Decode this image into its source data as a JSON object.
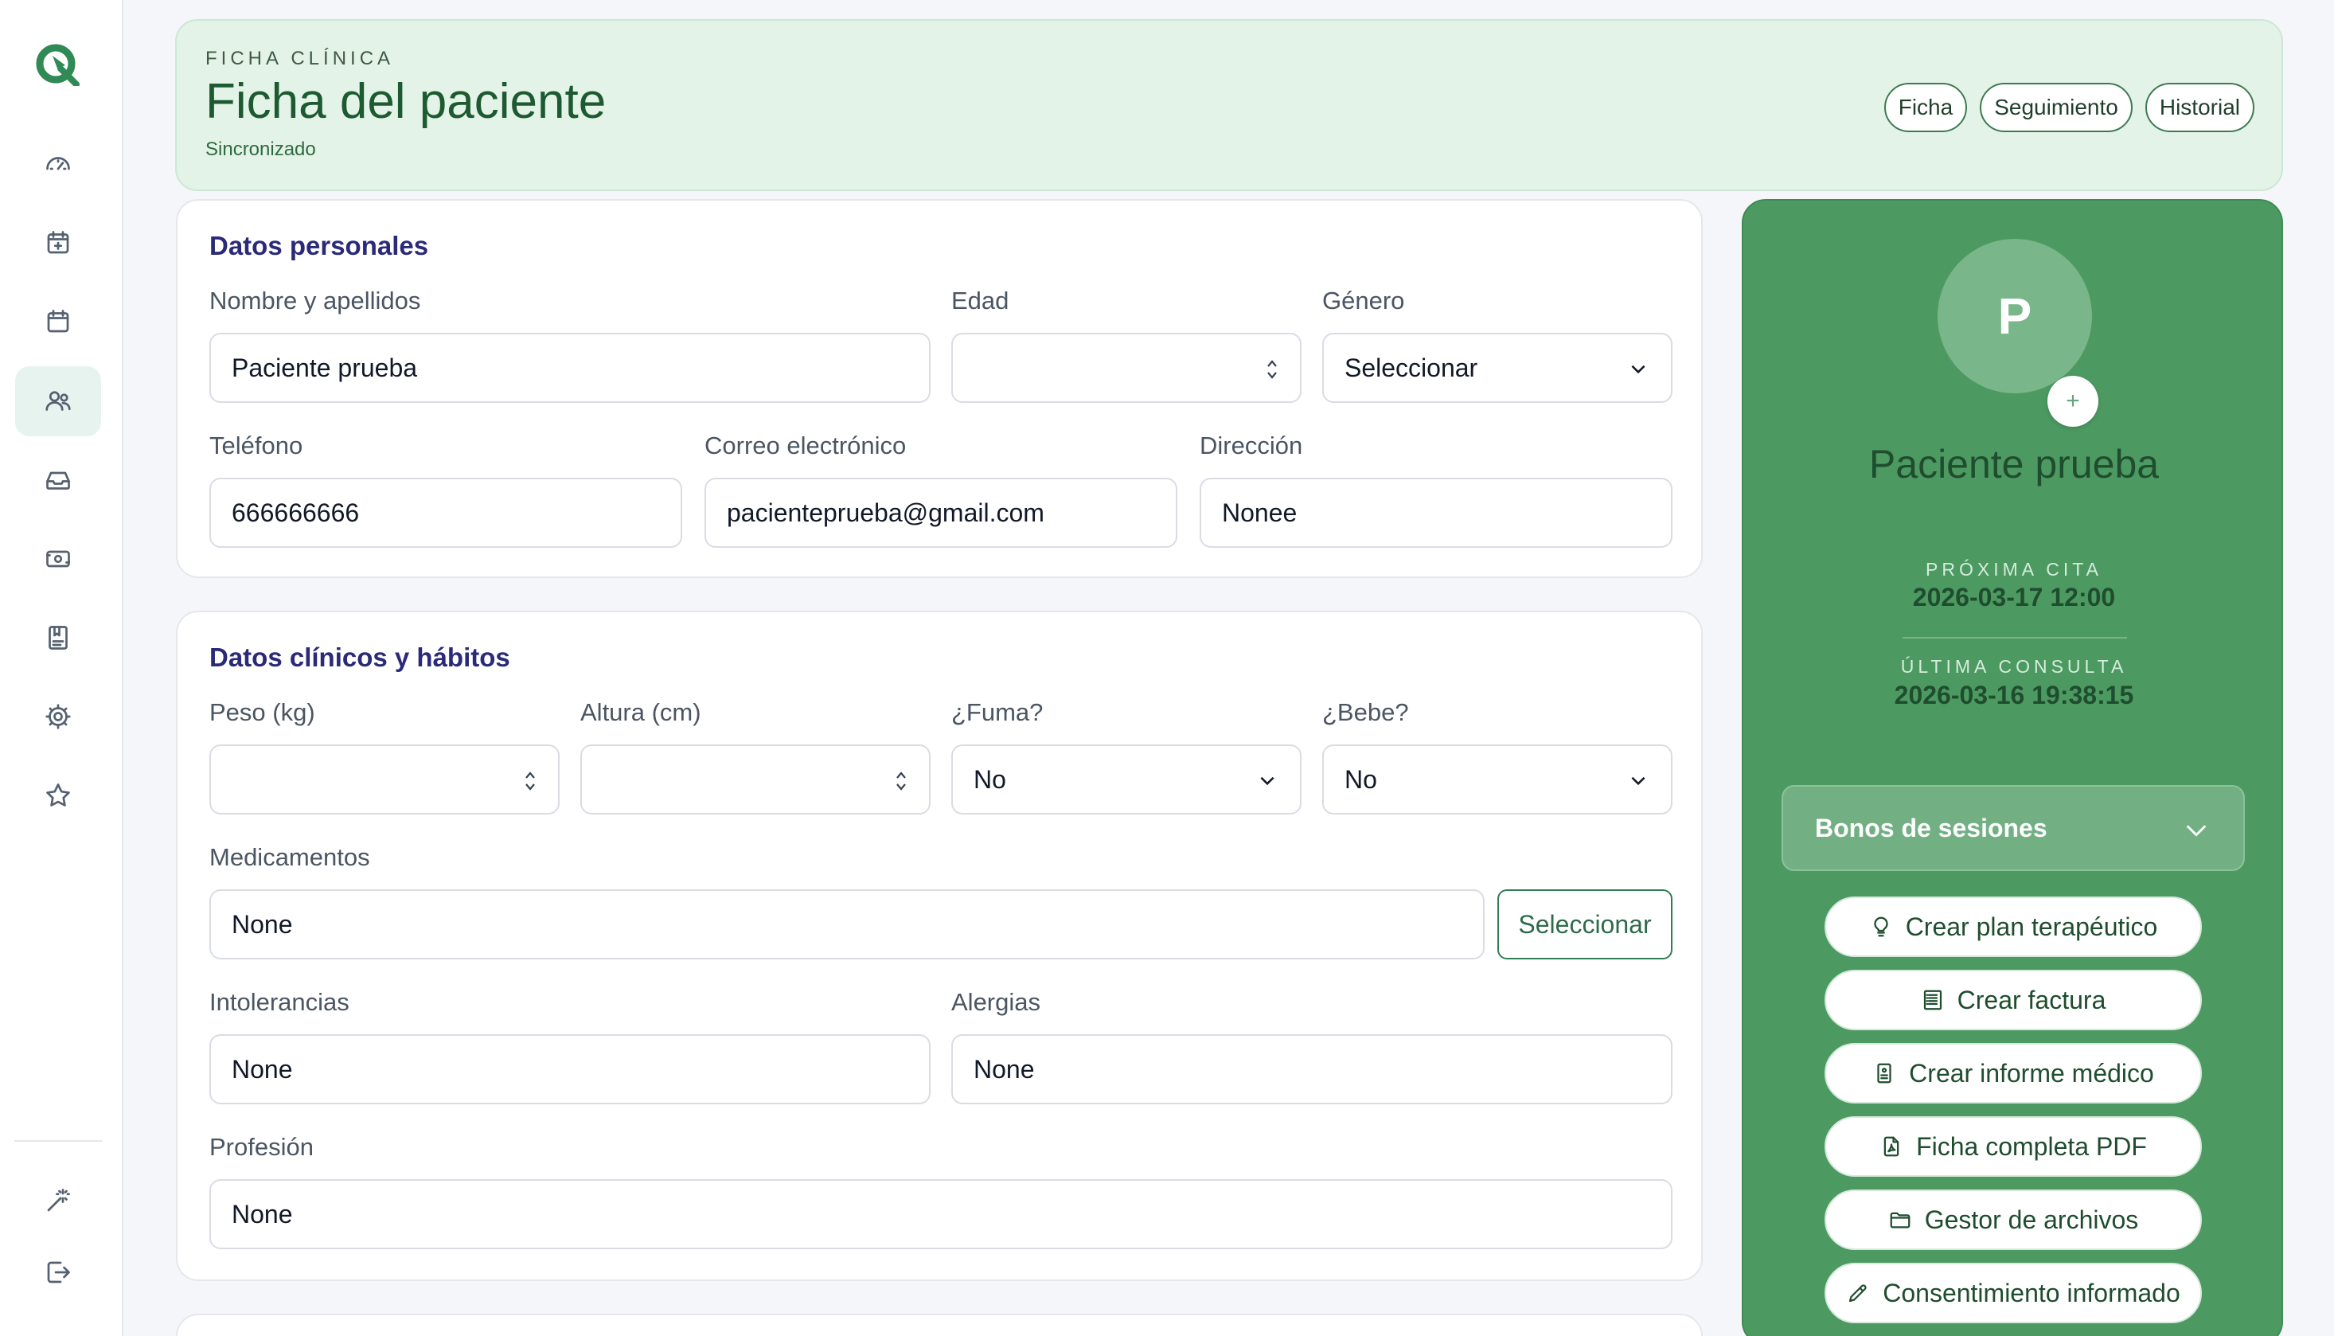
{
  "header": {
    "eyebrow": "FICHA CLÍNICA",
    "title": "Ficha del paciente",
    "sync_status": "Sincronizado",
    "tabs": [
      {
        "label": "Ficha"
      },
      {
        "label": "Seguimiento"
      },
      {
        "label": "Historial"
      }
    ]
  },
  "sidebar": {
    "items": [
      {
        "icon": "dashboard-icon"
      },
      {
        "icon": "calendar-add-icon"
      },
      {
        "icon": "calendar-icon"
      },
      {
        "icon": "patients-icon",
        "active": true
      },
      {
        "icon": "inbox-icon"
      },
      {
        "icon": "money-icon"
      },
      {
        "icon": "book-icon"
      },
      {
        "icon": "settings-icon"
      },
      {
        "icon": "star-icon"
      },
      {
        "icon": "magic-wand-icon"
      },
      {
        "icon": "logout-icon"
      }
    ]
  },
  "personal": {
    "title": "Datos personales",
    "name_label": "Nombre y apellidos",
    "name_value": "Paciente prueba",
    "age_label": "Edad",
    "age_value": "",
    "gender_label": "Género",
    "gender_value": "Seleccionar",
    "phone_label": "Teléfono",
    "phone_value": "666666666",
    "email_label": "Correo electrónico",
    "email_value": "pacienteprueba@gmail.com",
    "address_label": "Dirección",
    "address_value": "Nonee"
  },
  "clinical": {
    "title": "Datos clínicos y hábitos",
    "weight_label": "Peso (kg)",
    "weight_value": "",
    "height_label": "Altura (cm)",
    "height_value": "",
    "smoke_label": "¿Fuma?",
    "smoke_value": "No",
    "drink_label": "¿Bebe?",
    "drink_value": "No",
    "meds_label": "Medicamentos",
    "meds_value": "None",
    "meds_button": "Seleccionar",
    "intol_label": "Intolerancias",
    "intol_value": "None",
    "allergy_label": "Alergias",
    "allergy_value": "None",
    "profession_label": "Profesión",
    "profession_value": "None"
  },
  "patient": {
    "initial": "P",
    "add_photo": "+",
    "name": "Paciente prueba",
    "next_label": "PRÓXIMA CITA",
    "next_value": "2026-03-17 12:00",
    "last_label": "ÚLTIMA CONSULTA",
    "last_value": "2026-03-16 19:38:15",
    "bonos_label": "Bonos de sesiones",
    "actions": [
      {
        "label": "Crear plan terapéutico",
        "icon": "lightbulb-icon"
      },
      {
        "label": "Crear factura",
        "icon": "invoice-icon"
      },
      {
        "label": "Crear informe médico",
        "icon": "report-icon"
      },
      {
        "label": "Ficha completa PDF",
        "icon": "pdf-icon"
      },
      {
        "label": "Gestor de archivos",
        "icon": "folder-icon"
      },
      {
        "label": "Consentimiento informado",
        "icon": "pen-icon"
      }
    ]
  },
  "colors": {
    "accent_green": "#4c9a62",
    "header_bg": "#e3f3e7",
    "section_title": "#2b2a78"
  }
}
